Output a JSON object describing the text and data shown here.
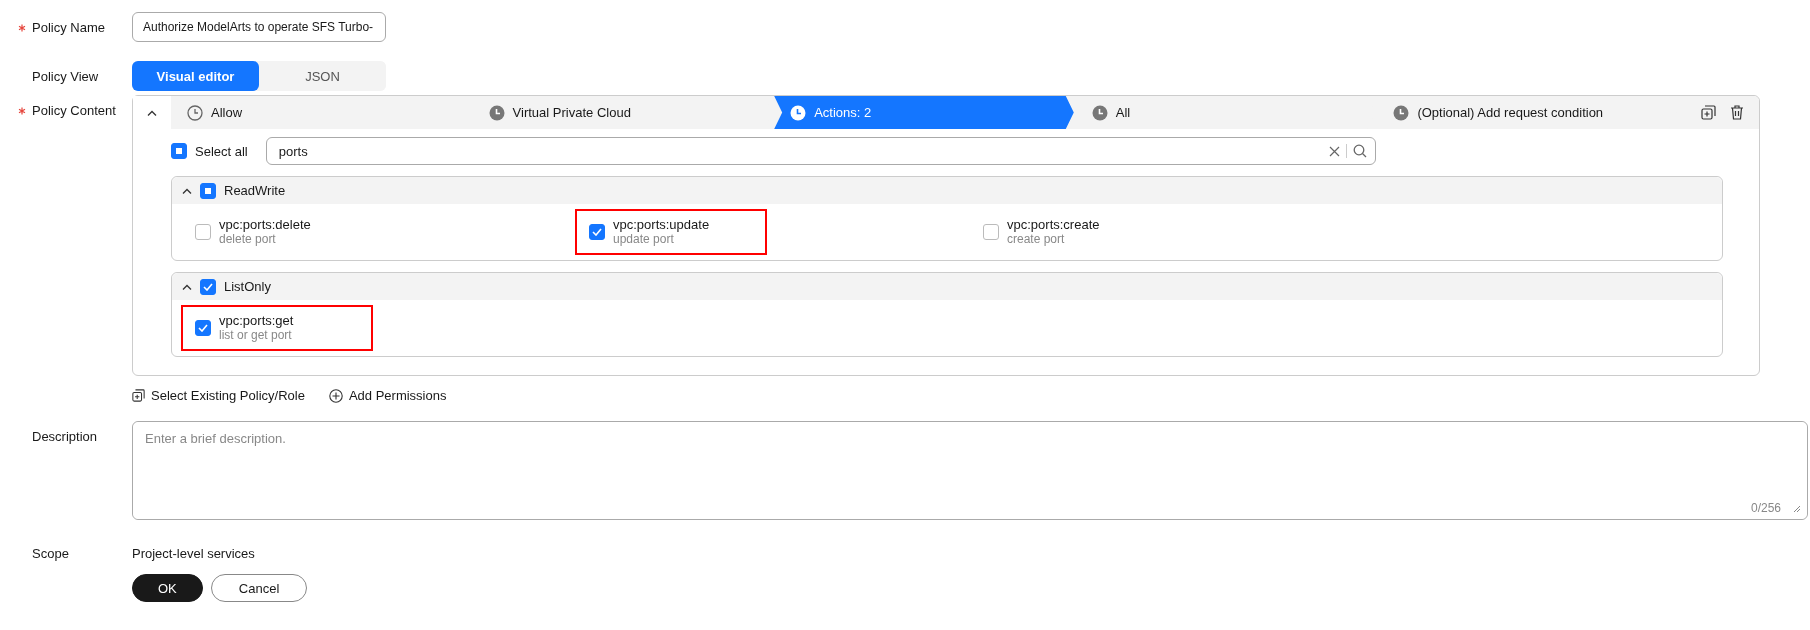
{
  "policy_name": {
    "label": "Policy Name",
    "required": true,
    "value": "Authorize ModelArts to operate SFS Turbo-"
  },
  "policy_view": {
    "label": "Policy View",
    "options": [
      {
        "label": "Visual editor",
        "selected": true
      },
      {
        "label": "JSON",
        "selected": false
      }
    ]
  },
  "policy_content": {
    "label": "Policy Content",
    "required": true,
    "steps": [
      {
        "label": "Allow",
        "selected": false,
        "done": true
      },
      {
        "label": "Virtual Private Cloud",
        "selected": false,
        "done": false
      },
      {
        "label": "Actions: 2",
        "selected": true,
        "done": false
      },
      {
        "label": "All",
        "selected": false,
        "done": false
      },
      {
        "label": "(Optional) Add request condition",
        "selected": false,
        "done": false
      }
    ],
    "select_all": {
      "label": "Select all",
      "indeterminate": true
    },
    "search": {
      "value": "ports"
    },
    "groups": [
      {
        "name": "ReadWrite",
        "expanded": true,
        "indeterminate": true,
        "actions": [
          {
            "name": "vpc:ports:delete",
            "description": "delete port",
            "checked": false,
            "highlighted": false
          },
          {
            "name": "vpc:ports:update",
            "description": "update port",
            "checked": true,
            "highlighted": true
          },
          {
            "name": "vpc:ports:create",
            "description": "create port",
            "checked": false,
            "highlighted": false
          }
        ]
      },
      {
        "name": "ListOnly",
        "expanded": true,
        "checked": true,
        "actions": [
          {
            "name": "vpc:ports:get",
            "description": "list or get port",
            "checked": true,
            "highlighted": true
          }
        ]
      }
    ]
  },
  "links": [
    {
      "kind": "select",
      "label": "Select Existing Policy/Role"
    },
    {
      "kind": "add",
      "label": "Add Permissions"
    }
  ],
  "description": {
    "label": "Description",
    "placeholder": "Enter a brief description.",
    "counter": "0/256"
  },
  "scope": {
    "label": "Scope",
    "value": "Project-level services"
  },
  "buttons": [
    {
      "kind": "primary",
      "label": "OK"
    },
    {
      "kind": "secondary",
      "label": "Cancel"
    }
  ]
}
